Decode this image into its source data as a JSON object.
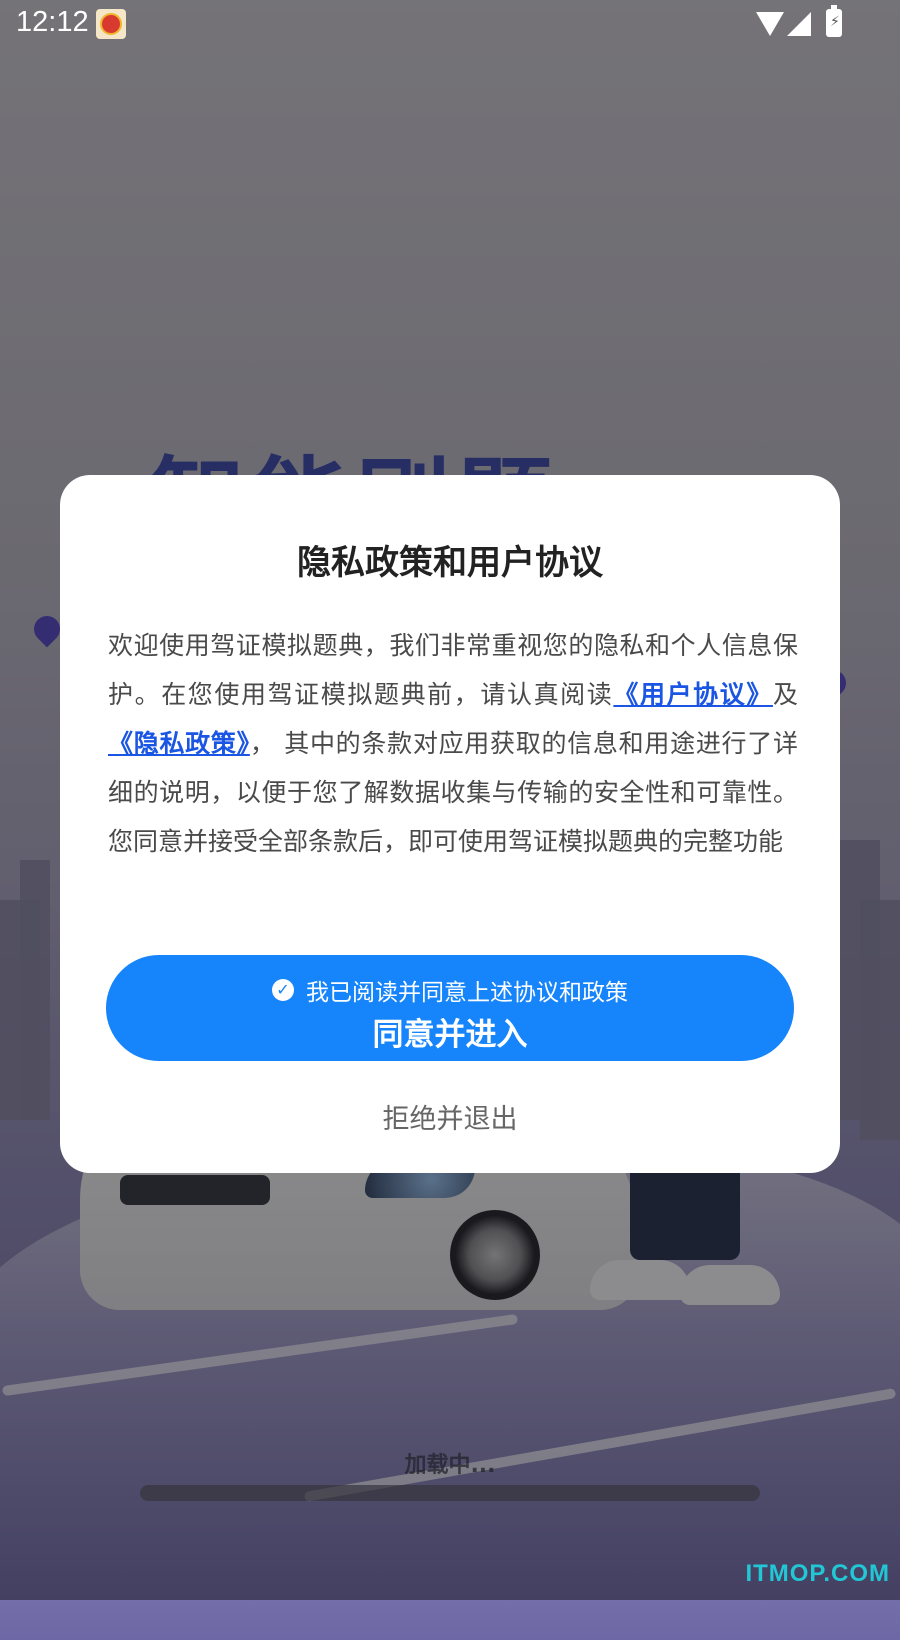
{
  "status_bar": {
    "time": "12:12"
  },
  "background": {
    "title": "智能刷题",
    "loading_text": "加载中...",
    "watermark": "ITMOP.COM"
  },
  "dialog": {
    "title": "隐私政策和用户协议",
    "body_part1": "欢迎使用驾证模拟题典，我们非常重视您的隐私和个人信息保护。在您使用驾证模拟题典前，请认真阅读",
    "user_agreement_link": "《用户协议》",
    "body_and": "及",
    "privacy_policy_link": "《隐私政策》",
    "body_part2": "， 其中的条款对应用获取的信息和用途进行了详细的说明，以便于您了解数据收集与传输的安全性和可靠性。您同意并接受全部条款后，即可使用驾证模拟题典的完整功能",
    "consent_label": "我已阅读并同意上述协议和政策",
    "agree_button": "同意并进入",
    "decline_button": "拒绝并退出"
  },
  "colors": {
    "primary": "#1684fb",
    "link": "#1a55e3",
    "dialog_bg": "#ffffff",
    "watermark": "#22c7d6"
  },
  "icons": [
    "app-notification-icon",
    "wifi-icon",
    "signal-icon",
    "battery-icon",
    "check-icon",
    "location-pin-icon"
  ]
}
